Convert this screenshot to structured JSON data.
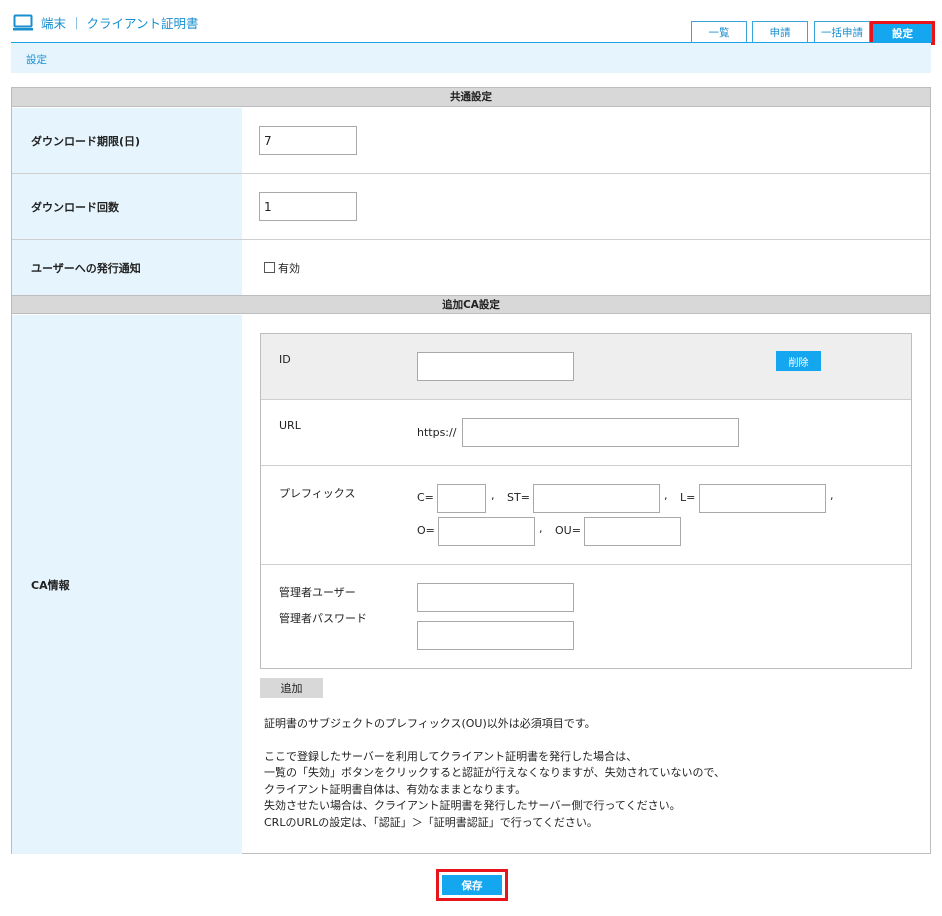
{
  "header": {
    "title": "端末 ｜ クライアント証明書",
    "icon": "monitor-icon",
    "accent_color": "#1a8fd0"
  },
  "tabs": [
    {
      "label": "一覧",
      "active": false
    },
    {
      "label": "申請",
      "active": false
    },
    {
      "label": "一括申請",
      "active": false
    },
    {
      "label": "設定",
      "active": true
    }
  ],
  "breadcrumb": "設定",
  "common_settings": {
    "heading": "共通設定",
    "download_period": {
      "label": "ダウンロード期限(日)",
      "value": "7"
    },
    "download_count": {
      "label": "ダウンロード回数",
      "value": "1"
    },
    "notify": {
      "label": "ユーザーへの発行通知",
      "checkbox_label": "有効",
      "checked": false
    }
  },
  "additional_ca": {
    "heading": "追加CA設定",
    "label": "CA情報",
    "id": {
      "label": "ID",
      "value": "",
      "delete_label": "削除"
    },
    "url": {
      "label": "URL",
      "prefix": "https://",
      "value": ""
    },
    "prefix": {
      "label": "プレフィックス",
      "c_label": "C=",
      "st_label": "ST=",
      "l_label": "L=",
      "o_label": "O=",
      "ou_label": "OU=",
      "comma": ","
    },
    "admin": {
      "user_label": "管理者ユーザー",
      "password_label": "管理者パスワード"
    },
    "add_label": "追加"
  },
  "notes": {
    "line1": "証明書のサブジェクトのプレフィックス(OU)以外は必須項目です。",
    "line2": "ここで登録したサーバーを利用してクライアント証明書を発行した場合は、",
    "line3": "一覧の「失効」ボタンをクリックすると認証が行えなくなりますが、失効されていないので、",
    "line4": "クライアント証明書自体は、有効なままとなります。",
    "line5": "失効させたい場合は、クライアント証明書を発行したサーバー側で行ってください。",
    "line6": "CRLのURLの設定は、「認証」＞「証明書認証」で行ってください。"
  },
  "save_label": "保存"
}
